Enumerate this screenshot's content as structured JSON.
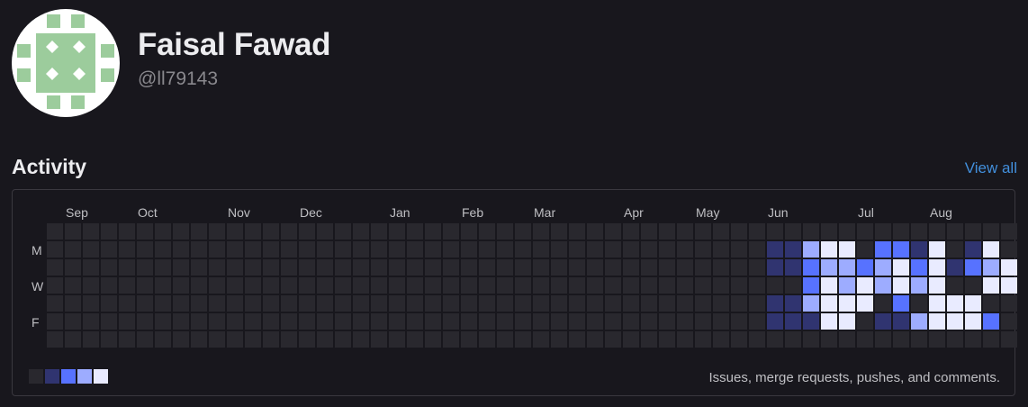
{
  "profile": {
    "name": "Faisal Fawad",
    "handle": "@ll79143",
    "avatar_icon": "identicon-avatar",
    "avatar_color": "#9ccc9c"
  },
  "activity": {
    "title": "Activity",
    "view_all": "View all",
    "months": [
      "Sep",
      "Oct",
      "Nov",
      "Dec",
      "Jan",
      "Feb",
      "Mar",
      "Apr",
      "May",
      "Jun",
      "Jul",
      "Aug"
    ],
    "day_labels": [
      "M",
      "W",
      "F"
    ],
    "legend_caption": "Issues, merge requests, pushes, and comments.",
    "level_colors": [
      "#29282e",
      "#303470",
      "#5772ff",
      "#9dacff",
      "#e9ebff"
    ],
    "accent_color": "#428fdc",
    "heatmap_levels": [
      [
        0,
        0,
        0,
        0,
        0,
        0,
        0,
        0,
        0,
        0,
        0,
        0,
        0,
        0,
        0,
        0,
        0,
        0,
        0,
        0,
        0,
        0,
        0,
        0,
        0,
        0,
        0,
        0,
        0,
        0,
        0,
        0,
        0,
        0,
        0,
        0,
        0,
        0,
        0,
        0,
        0,
        0,
        0,
        0,
        0,
        0,
        0,
        0,
        0,
        0,
        0,
        0,
        0,
        0
      ],
      [
        0,
        0,
        0,
        0,
        0,
        0,
        0,
        0,
        0,
        0,
        0,
        0,
        0,
        0,
        0,
        0,
        0,
        0,
        0,
        0,
        0,
        0,
        0,
        0,
        0,
        0,
        0,
        0,
        0,
        0,
        0,
        0,
        0,
        0,
        0,
        0,
        0,
        0,
        0,
        0,
        1,
        1,
        3,
        4,
        4,
        0,
        2,
        2,
        1,
        4,
        0,
        1,
        4,
        0
      ],
      [
        0,
        0,
        0,
        0,
        0,
        0,
        0,
        0,
        0,
        0,
        0,
        0,
        0,
        0,
        0,
        0,
        0,
        0,
        0,
        0,
        0,
        0,
        0,
        0,
        0,
        0,
        0,
        0,
        0,
        0,
        0,
        0,
        0,
        0,
        0,
        0,
        0,
        0,
        0,
        0,
        1,
        1,
        2,
        3,
        3,
        2,
        3,
        4,
        2,
        4,
        1,
        2,
        3,
        4
      ],
      [
        0,
        0,
        0,
        0,
        0,
        0,
        0,
        0,
        0,
        0,
        0,
        0,
        0,
        0,
        0,
        0,
        0,
        0,
        0,
        0,
        0,
        0,
        0,
        0,
        0,
        0,
        0,
        0,
        0,
        0,
        0,
        0,
        0,
        0,
        0,
        0,
        0,
        0,
        0,
        0,
        0,
        0,
        2,
        4,
        3,
        4,
        3,
        4,
        3,
        4,
        0,
        0,
        4,
        4
      ],
      [
        0,
        0,
        0,
        0,
        0,
        0,
        0,
        0,
        0,
        0,
        0,
        0,
        0,
        0,
        0,
        0,
        0,
        0,
        0,
        0,
        0,
        0,
        0,
        0,
        0,
        0,
        0,
        0,
        0,
        0,
        0,
        0,
        0,
        0,
        0,
        0,
        0,
        0,
        0,
        0,
        1,
        1,
        3,
        4,
        4,
        4,
        0,
        2,
        0,
        4,
        4,
        4,
        0,
        0
      ],
      [
        0,
        0,
        0,
        0,
        0,
        0,
        0,
        0,
        0,
        0,
        0,
        0,
        0,
        0,
        0,
        0,
        0,
        0,
        0,
        0,
        0,
        0,
        0,
        0,
        0,
        0,
        0,
        0,
        0,
        0,
        0,
        0,
        0,
        0,
        0,
        0,
        0,
        0,
        0,
        0,
        1,
        1,
        1,
        4,
        4,
        0,
        1,
        1,
        3,
        4,
        4,
        4,
        2,
        0
      ],
      [
        0,
        0,
        0,
        0,
        0,
        0,
        0,
        0,
        0,
        0,
        0,
        0,
        0,
        0,
        0,
        0,
        0,
        0,
        0,
        0,
        0,
        0,
        0,
        0,
        0,
        0,
        0,
        0,
        0,
        0,
        0,
        0,
        0,
        0,
        0,
        0,
        0,
        0,
        0,
        0,
        0,
        0,
        0,
        0,
        0,
        0,
        0,
        0,
        0,
        0,
        0,
        0,
        0,
        0
      ]
    ]
  }
}
